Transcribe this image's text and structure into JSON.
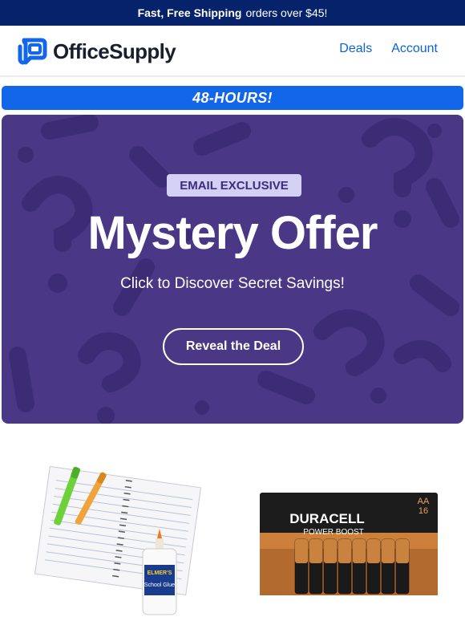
{
  "topbar": {
    "bold": "Fast, Free Shipping",
    "rest": "orders over $45!"
  },
  "header": {
    "logo_text": "OfficeSupply",
    "nav": [
      {
        "label": "Deals"
      },
      {
        "label": "Account"
      }
    ]
  },
  "timer": {
    "label": "48-HOURS!"
  },
  "hero": {
    "badge": "EMAIL EXCLUSIVE",
    "title": "Mystery Offer",
    "subtitle": "Click to Discover Secret Savings!",
    "cta": "Reveal the Deal"
  },
  "products": [
    {
      "name": "school-supplies",
      "glue_brand": "ELMER'S",
      "glue_label": "School Glue"
    },
    {
      "name": "batteries",
      "brand": "DURACELL",
      "line": "POWER BOOST",
      "size": "AA",
      "count": "16"
    }
  ],
  "colors": {
    "topbar": "#05226b",
    "link": "#0b63d6",
    "timer": "#1266ea",
    "hero": "#4a3886",
    "badge": "#d3d0f3"
  }
}
